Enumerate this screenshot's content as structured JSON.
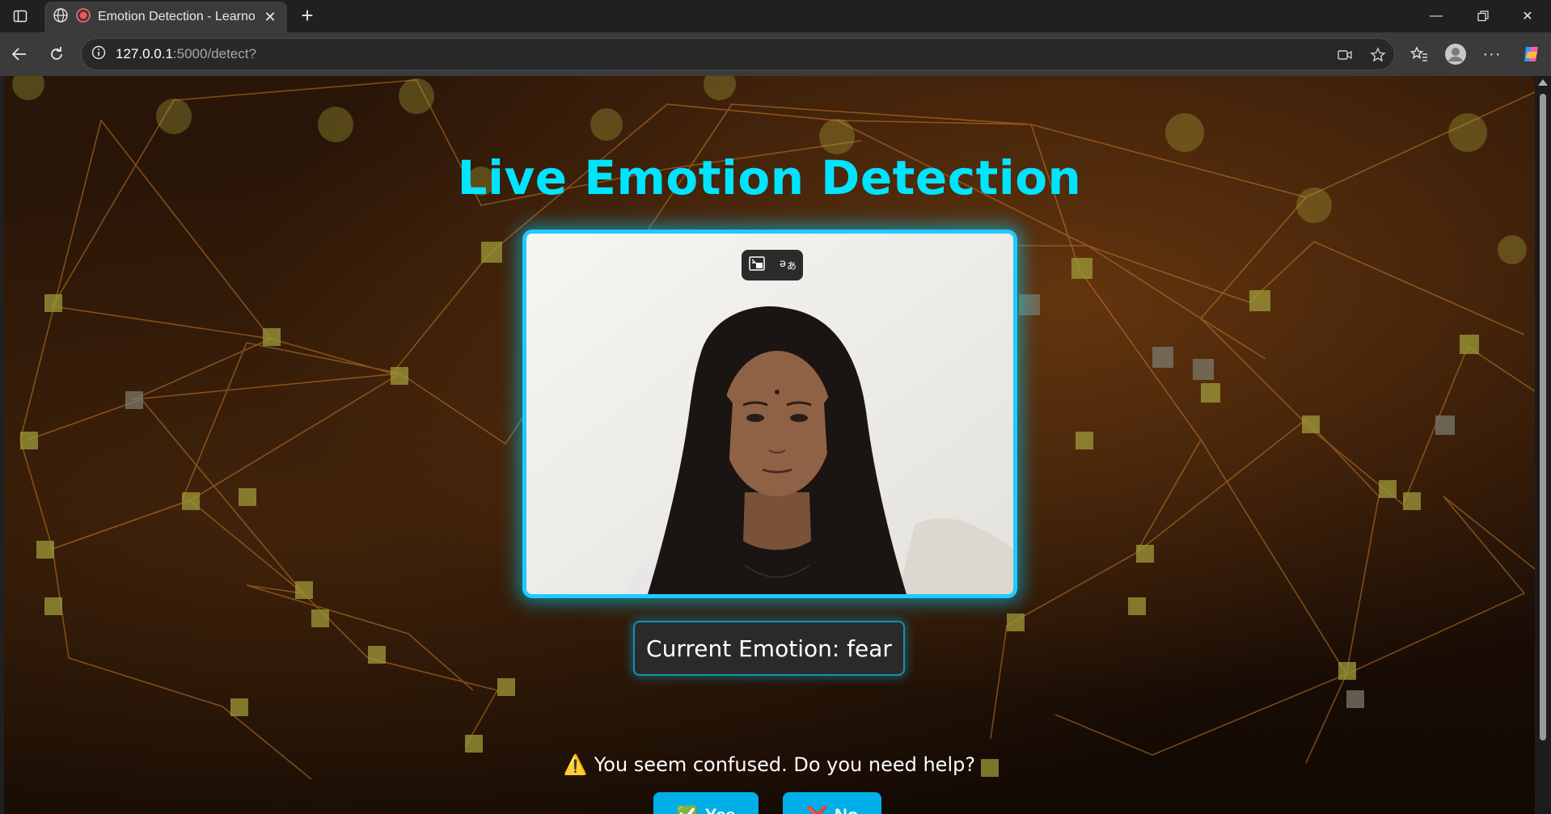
{
  "browser": {
    "tab": {
      "title": "Emotion Detection - Learnor"
    },
    "address": {
      "host": "127.0.0.1",
      "path": ":5000/detect?"
    }
  },
  "page": {
    "title": "Live Emotion Detection",
    "emotion_label": "Current Emotion: fear",
    "help_prompt": "You seem confused. Do you need help?",
    "help_icon": "⚠️",
    "buttons": {
      "yes": {
        "icon": "✅",
        "label": "Yes"
      },
      "no": {
        "icon": "❌",
        "label": "No"
      }
    }
  },
  "colors": {
    "title": "#00e5ff",
    "frame_border": "#1ecbff",
    "button_bg": "#00aee8"
  }
}
